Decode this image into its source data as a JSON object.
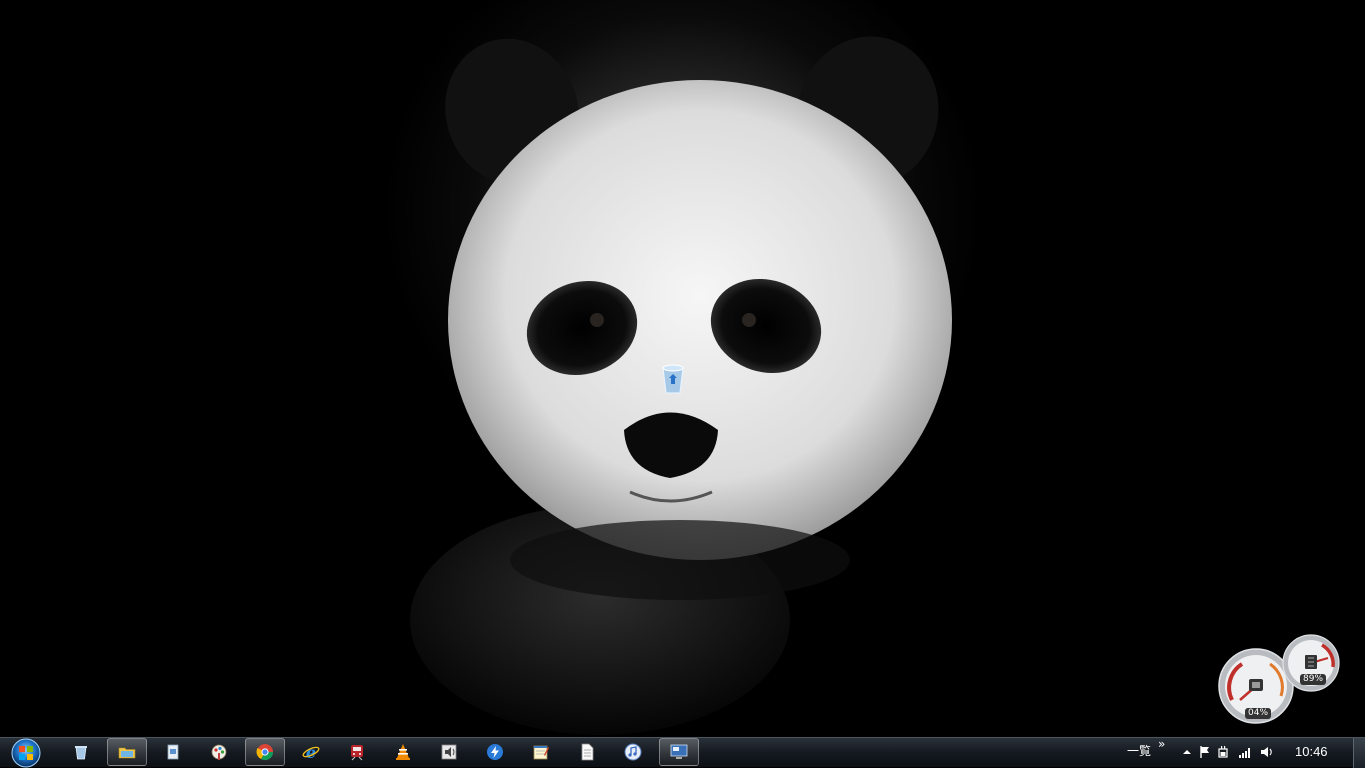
{
  "desktop": {
    "wallpaper": "panda-wallpaper",
    "icons": [
      {
        "name": "recycle-bin-icon"
      }
    ]
  },
  "gadgets": {
    "cpu_meter": {
      "value_label": "04%",
      "value": 4
    },
    "memory_meter": {
      "value_label": "89%",
      "value": 89
    }
  },
  "taskbar": {
    "start_icon": "windows-orb-icon",
    "buttons": [
      {
        "name": "recycle-bin-icon",
        "active": false
      },
      {
        "name": "explorer-icon",
        "active": true
      },
      {
        "name": "document-icon",
        "active": false
      },
      {
        "name": "paint-icon",
        "active": false
      },
      {
        "name": "chrome-icon",
        "active": true
      },
      {
        "name": "internet-explorer-icon",
        "active": false
      },
      {
        "name": "train-app-icon",
        "active": false
      },
      {
        "name": "vlc-icon",
        "active": false
      },
      {
        "name": "sound-recorder-icon",
        "active": false
      },
      {
        "name": "lightning-app-icon",
        "active": false
      },
      {
        "name": "notepad-icon",
        "active": false
      },
      {
        "name": "text-file-icon",
        "active": false
      },
      {
        "name": "itunes-icon",
        "active": false
      },
      {
        "name": "remote-desktop-icon",
        "active": true
      }
    ],
    "tray": {
      "language_label": "一覧",
      "chevron_label": "»",
      "clock": "10:46"
    }
  },
  "colors": {
    "taskbar_bg": "#151a20",
    "gauge_red": "#c0302a"
  }
}
